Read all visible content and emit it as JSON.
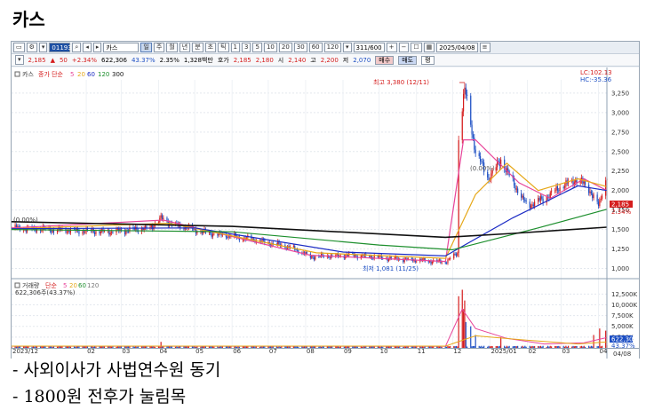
{
  "page_title": "카스",
  "toolbar": {
    "code": "011930",
    "name": "카스",
    "periods": [
      "주",
      "월",
      "년",
      "분",
      "초",
      "틱"
    ],
    "intervals": [
      "1",
      "3",
      "5",
      "10",
      "20",
      "30",
      "60",
      "120"
    ],
    "count": "311/600",
    "date": "2025/04/08"
  },
  "quote": {
    "price": "2,185",
    "change": "50",
    "change_pct": "+2.34%",
    "volume": "622,306",
    "vol_ratio": "43.37%",
    "turnover_pct": "2.35%",
    "amount": "1,328백만",
    "ask_label": "호가",
    "ask1": "2,185",
    "ask2": "2,180",
    "open_label": "시",
    "open": "2,140",
    "high_label": "고",
    "high": "2,200",
    "low_label": "저",
    "low": "2,070",
    "buy_label": "매수",
    "sell_label": "매도",
    "flat_label": "평"
  },
  "price_panel": {
    "legend_name": "카스",
    "legend_ma": "종가 단순",
    "legend_periods": [
      "5",
      "20",
      "60",
      "120",
      "300"
    ],
    "lc_label": "LC:102.13",
    "hc_label": "HC:-35.36",
    "max_label": "최고 3,380 (12/11)",
    "min_label": "최저 1,081 (11/25)",
    "base_label": "(0.00%)",
    "mid_label": "(0.00%)",
    "current_tag": "2,185",
    "current_pct": "2.34%"
  },
  "volume_panel": {
    "legend_name": "거래량",
    "legend_ma": "단순",
    "legend_periods": [
      "5",
      "20",
      "60",
      "120"
    ],
    "legend_value": "622,306주(43.37%)",
    "tag_value": "622,306",
    "tag_pct": "43.37%"
  },
  "x_axis": {
    "labels": [
      "2023/12",
      "02",
      "03",
      "04",
      "05",
      "06",
      "07",
      "08",
      "09",
      "10",
      "11",
      "12",
      "2025/01",
      "02",
      "03",
      "04"
    ],
    "end_label": "04/08"
  },
  "notes": [
    "- 사외이사가 사법연수원 동기",
    "- 1800원 전후가 눌림목"
  ],
  "colors": {
    "up": "#d51d1d",
    "down": "#1d4fc4",
    "ma5": "#e8459a",
    "ma20": "#e6a81a",
    "ma60": "#1b2bc4",
    "ma120": "#1d8f2d",
    "ma300": "#111111"
  },
  "chart_data": {
    "type": "candlestick",
    "y_ticks": [
      1000,
      1250,
      1500,
      1750,
      2000,
      2250,
      2500,
      2750,
      3000,
      3250
    ],
    "ylim": [
      960,
      3420
    ],
    "vol_ticks": [
      2500000,
      5000000,
      7500000,
      10000000,
      12500000
    ],
    "vol_tick_labels": [
      "2,500K",
      "5,000K",
      "7,500K",
      "10,000K",
      "12,500K"
    ],
    "vol_max": 13600000,
    "x_range": [
      "2023-12-01",
      "2025-04-08"
    ],
    "price_checkpoints": [
      [
        "2023-12-01",
        1520
      ],
      [
        "2024-01-15",
        1490
      ],
      [
        "2024-02-20",
        1470
      ],
      [
        "2024-03-25",
        1520
      ],
      [
        "2024-04-03",
        1640
      ],
      [
        "2024-04-15",
        1560
      ],
      [
        "2024-05-10",
        1460
      ],
      [
        "2024-06-15",
        1380
      ],
      [
        "2024-07-20",
        1270
      ],
      [
        "2024-08-05",
        1150
      ],
      [
        "2024-09-10",
        1170
      ],
      [
        "2024-10-10",
        1130
      ],
      [
        "2024-11-25",
        1081
      ],
      [
        "2024-12-05",
        1200
      ],
      [
        "2024-12-06",
        2700
      ],
      [
        "2024-12-11",
        3300
      ],
      [
        "2024-12-20",
        2500
      ],
      [
        "2024-12-31",
        2150
      ],
      [
        "2025-01-10",
        2400
      ],
      [
        "2025-01-20",
        2100
      ],
      [
        "2025-02-01",
        1800
      ],
      [
        "2025-02-15",
        1900
      ],
      [
        "2025-03-01",
        2050
      ],
      [
        "2025-03-15",
        2150
      ],
      [
        "2025-03-25",
        2000
      ],
      [
        "2025-04-01",
        1800
      ],
      [
        "2025-04-08",
        2185
      ]
    ],
    "ma_checkpoints": {
      "ma5": [
        [
          "2023-12-01",
          1520
        ],
        [
          "2024-04-05",
          1620
        ],
        [
          "2024-08-05",
          1170
        ],
        [
          "2024-11-25",
          1090
        ],
        [
          "2024-12-10",
          2650
        ],
        [
          "2024-12-20",
          2650
        ],
        [
          "2025-01-25",
          2100
        ],
        [
          "2025-02-20",
          1900
        ],
        [
          "2025-03-20",
          2150
        ],
        [
          "2025-04-08",
          2000
        ]
      ],
      "ma20": [
        [
          "2023-12-01",
          1510
        ],
        [
          "2024-04-10",
          1580
        ],
        [
          "2024-08-10",
          1200
        ],
        [
          "2024-11-25",
          1130
        ],
        [
          "2024-12-20",
          1950
        ],
        [
          "2025-01-15",
          2350
        ],
        [
          "2025-02-10",
          2000
        ],
        [
          "2025-03-15",
          2150
        ],
        [
          "2025-04-08",
          2050
        ]
      ],
      "ma60": [
        [
          "2023-12-01",
          1510
        ],
        [
          "2024-05-01",
          1520
        ],
        [
          "2024-09-01",
          1210
        ],
        [
          "2024-11-25",
          1160
        ],
        [
          "2025-01-20",
          1650
        ],
        [
          "2025-03-15",
          2060
        ],
        [
          "2025-04-08",
          2000
        ]
      ],
      "ma120": [
        [
          "2023-12-01",
          1500
        ],
        [
          "2024-06-01",
          1470
        ],
        [
          "2024-10-01",
          1300
        ],
        [
          "2024-12-01",
          1240
        ],
        [
          "2025-02-10",
          1520
        ],
        [
          "2025-04-08",
          1760
        ]
      ],
      "ma300": [
        [
          "2023-12-01",
          1600
        ],
        [
          "2024-06-01",
          1540
        ],
        [
          "2024-11-25",
          1400
        ],
        [
          "2025-01-20",
          1450
        ],
        [
          "2025-04-08",
          1530
        ]
      ]
    },
    "volume_spikes": [
      [
        "2024-04-03",
        1400000
      ],
      [
        "2024-12-06",
        12000000
      ],
      [
        "2024-12-09",
        13500000
      ],
      [
        "2024-12-10",
        9000000
      ],
      [
        "2024-12-11",
        11000000
      ],
      [
        "2024-12-12",
        6000000
      ],
      [
        "2024-12-16",
        5000000
      ],
      [
        "2024-12-20",
        3000000
      ],
      [
        "2025-01-10",
        2500000
      ],
      [
        "2025-03-28",
        3000000
      ],
      [
        "2025-04-02",
        4500000
      ],
      [
        "2025-04-07",
        4000000
      ],
      [
        "2025-04-08",
        622306
      ]
    ]
  }
}
